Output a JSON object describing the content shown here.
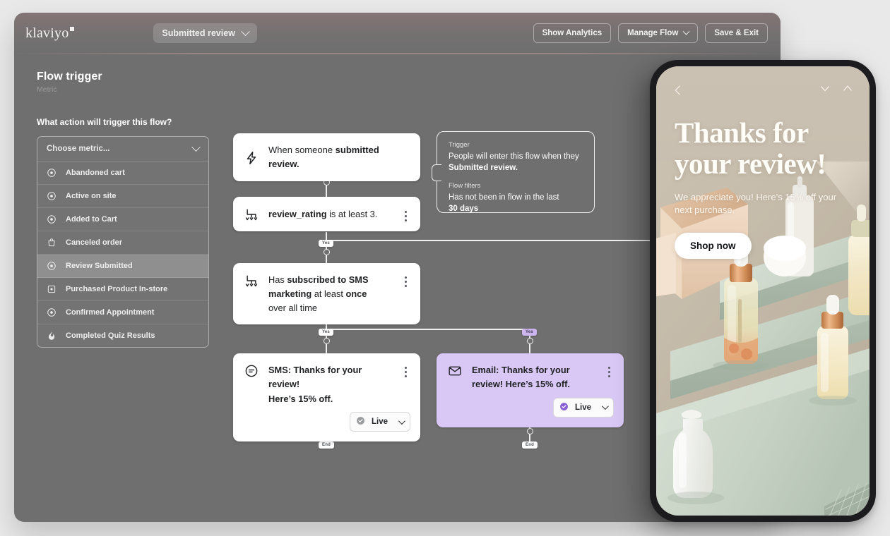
{
  "app": {
    "brand": "klaviyo",
    "flow_selector": "Submitted review",
    "buttons": {
      "show_analytics": "Show Analytics",
      "manage_flow": "Manage Flow",
      "save_exit": "Save & Exit"
    }
  },
  "left_panel": {
    "title": "Flow trigger",
    "subtitle": "Metric",
    "question": "What action will trigger this flow?",
    "select_placeholder": "Choose metric...",
    "metrics": [
      {
        "label": "Abandoned cart",
        "icon": "target-icon",
        "selected": false
      },
      {
        "label": "Active on site",
        "icon": "target-icon",
        "selected": false
      },
      {
        "label": "Added to Cart",
        "icon": "target-icon",
        "selected": false
      },
      {
        "label": "Canceled order",
        "icon": "bag-icon",
        "selected": false
      },
      {
        "label": "Review Submitted",
        "icon": "target-icon",
        "selected": true
      },
      {
        "label": "Purchased Product In-store",
        "icon": "square-dot-icon",
        "selected": false
      },
      {
        "label": "Confirmed Appointment",
        "icon": "target-icon",
        "selected": false
      },
      {
        "label": "Completed Quiz Results",
        "icon": "flame-icon",
        "selected": false
      }
    ]
  },
  "flow": {
    "trigger_node": {
      "icon": "lightning-icon",
      "text_plain": "When someone ",
      "text_bold": "submitted review."
    },
    "condition_1": {
      "icon": "branch-icon",
      "text_bold": "review_rating",
      "text_plain": " is at least 3."
    },
    "condition_2": {
      "icon": "branch-icon",
      "line1_plain": "Has ",
      "line1_bold": "subscribed to SMS",
      "line2_bold": "marketing",
      "line2_plain": " at least ",
      "line2_bold2": "once",
      "line3": "over all time"
    },
    "sms_node": {
      "icon": "sms-icon",
      "line1": "SMS: Thanks for your review!",
      "line2": "Here’s 15% off.",
      "status": "Live"
    },
    "email_node": {
      "icon": "envelope-icon",
      "line1": "Email: Thanks for your",
      "line2": "review! Here’s 15% off.",
      "status": "Live"
    },
    "badges": {
      "yes_1": "Yes",
      "yes_2": "Yes",
      "yes_3": "Yes",
      "end_1": "End",
      "end_2": "End"
    }
  },
  "callout": {
    "trigger_label": "Trigger",
    "trigger_text_plain": "People will enter this flow when they",
    "trigger_text_bold": "Submitted review.",
    "filters_label": "Flow filters",
    "filters_text_plain": "Has not been in flow in the last",
    "filters_text_bold": "30 days"
  },
  "phone": {
    "headline_line1": "Thanks for",
    "headline_line2": "your review!",
    "body": "We appreciate you! Here’s 15% off your next purchase.",
    "cta": "Shop now"
  },
  "colors": {
    "canvas": "#6f6f6f",
    "email_node": "#d9c8f5",
    "badge_purple": "#cdb6f0",
    "page_bg": "#e9e9e9"
  }
}
